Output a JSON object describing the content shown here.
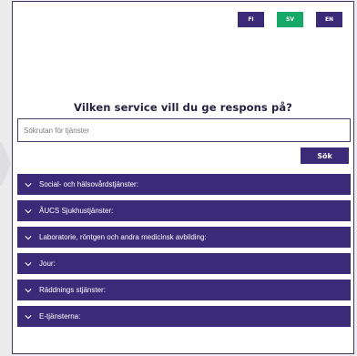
{
  "languages": [
    {
      "label": "FI",
      "active": false
    },
    {
      "label": "SV",
      "active": true
    },
    {
      "label": "EN",
      "active": false
    }
  ],
  "heading": "Vilken service vill du ge respons på?",
  "search": {
    "placeholder": "Sökrutan för tjänster",
    "value": "",
    "button_label": "Sök"
  },
  "accordion": [
    {
      "label": "Social- och hälsovårdstjänster:",
      "icon": "chevron-down-icon"
    },
    {
      "label": "ÅUCS Sjukhustjänster:",
      "icon": "chevron-down-icon"
    },
    {
      "label": "Laboratorie, röntgen och andra medicinsk avbilding:",
      "icon": "chevron-down-icon"
    },
    {
      "label": "Jour:",
      "icon": "chevron-down-icon"
    },
    {
      "label": "Räddnings stjänster:",
      "icon": "chevron-down-icon"
    },
    {
      "label": "E-tjänsterna:",
      "icon": "chevron-down-icon"
    }
  ],
  "colors": {
    "primary": "#3b2a78",
    "active_language": "#15a866",
    "heading": "#26203f"
  }
}
